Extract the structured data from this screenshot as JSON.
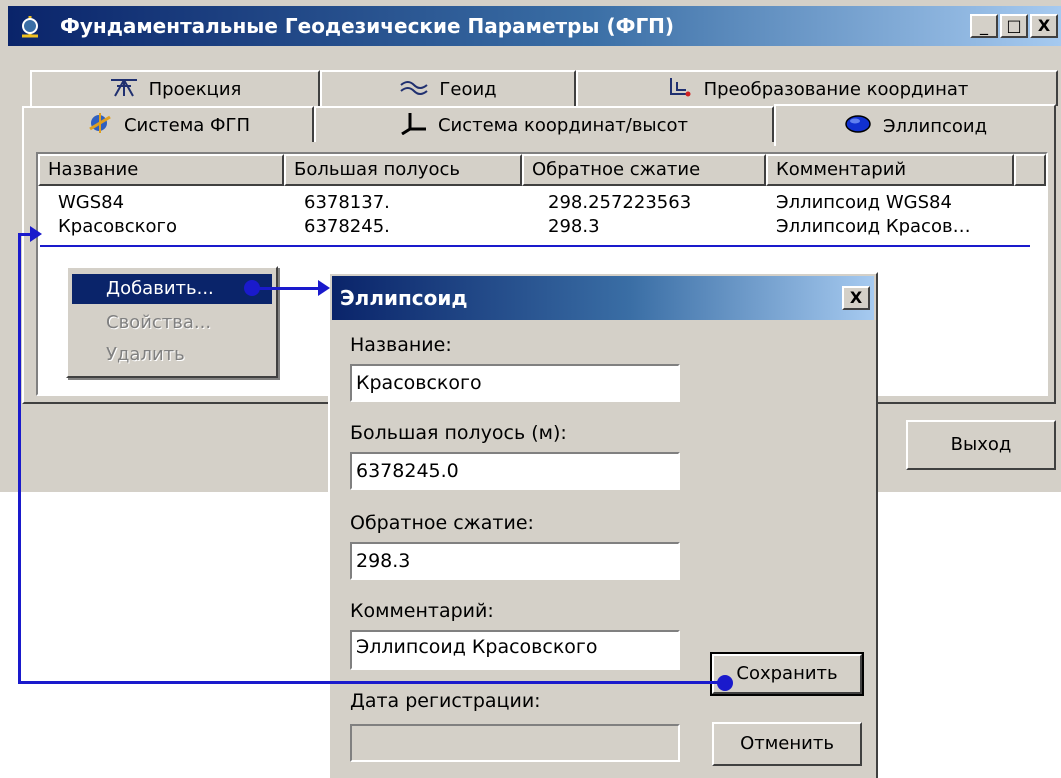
{
  "window": {
    "title": "Фундаментальные Геодезические Параметры (ФГП)",
    "min_label": "_",
    "max_label": "□",
    "close_label": "X"
  },
  "tabs_row1": [
    {
      "label": "Проекция",
      "icon": "projection-icon"
    },
    {
      "label": "Геоид",
      "icon": "geoid-icon"
    },
    {
      "label": "Преобразование координат",
      "icon": "coordinate-transform-icon"
    }
  ],
  "tabs_row2": [
    {
      "label": "Система ФГП",
      "icon": "fgp-system-icon"
    },
    {
      "label": "Система координат/высот",
      "icon": "coordinate-system-icon"
    },
    {
      "label": "Эллипсоид",
      "icon": "ellipsoid-icon",
      "active": true
    }
  ],
  "table": {
    "columns": [
      "Название",
      "Большая полуось",
      "Обратное сжатие",
      "Комментарий"
    ],
    "rows": [
      [
        "WGS84",
        "6378137.",
        "298.257223563",
        "Эллипсоид WGS84"
      ],
      [
        "Красовского",
        "6378245.",
        "298.3",
        "Эллипсоид Красов…"
      ]
    ]
  },
  "context_menu": {
    "items": [
      {
        "label": "Добавить...",
        "state": "selected"
      },
      {
        "label": "Свойства...",
        "state": "disabled"
      },
      {
        "label": "Удалить",
        "state": "disabled"
      }
    ]
  },
  "main_buttons": {
    "exit_label": "Выход"
  },
  "dialog": {
    "title": "Эллипсоид",
    "close_label": "X",
    "name_label": "Название:",
    "name_value": "Красовского",
    "axis_label": "Большая полуось (м):",
    "axis_value": "6378245.0",
    "flattening_label": "Обратное сжатие:",
    "flattening_value": "298.3",
    "comment_label": "Комментарий:",
    "comment_value": "Эллипсоид Красовского",
    "date_label": "Дата регистрации:",
    "date_value": "",
    "save_label": "Сохранить",
    "cancel_label": "Отменить"
  },
  "colors": {
    "title_bar_start": "#0a246a",
    "title_bar_end": "#a6caf0",
    "connector": "#1a1acc",
    "face": "#d4d0c8"
  }
}
